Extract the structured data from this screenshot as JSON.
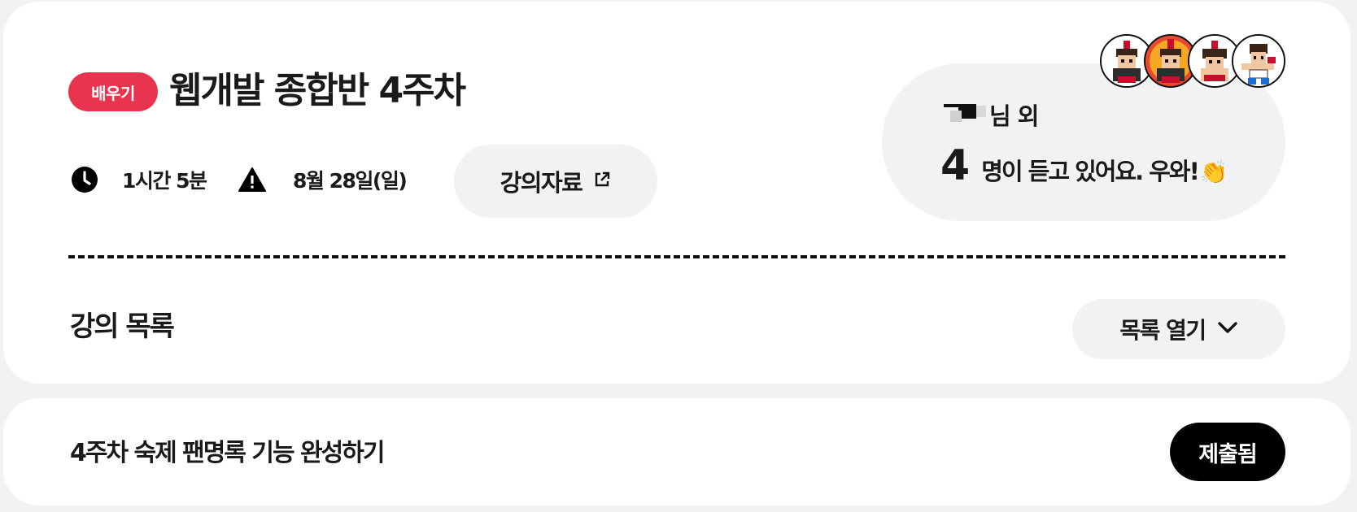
{
  "week": {
    "badge": "배우기",
    "title": "웹개발 종합반 4주차",
    "duration": "1시간 5분",
    "deadline": "8월 28일(일)",
    "material_button": "강의자료",
    "listeners": {
      "name_suffix": "님 외",
      "count": "4",
      "text": "명이 듣고 있어요. 우와!",
      "emoji": "👏",
      "avatar_count": 4
    },
    "lecture_list_title": "강의 목록",
    "open_list_button": "목록 열기"
  },
  "homework": {
    "title": "4주차 숙제 팬명록 기능 완성하기",
    "status_button": "제출됨"
  },
  "colors": {
    "background": "#f1f2f4",
    "card": "#ffffff",
    "badge": "#e8344e",
    "submitted": "#000000"
  },
  "icons": [
    "clock-icon",
    "warning-icon",
    "external-link-icon",
    "chevron-down-icon",
    "clap-emoji"
  ]
}
